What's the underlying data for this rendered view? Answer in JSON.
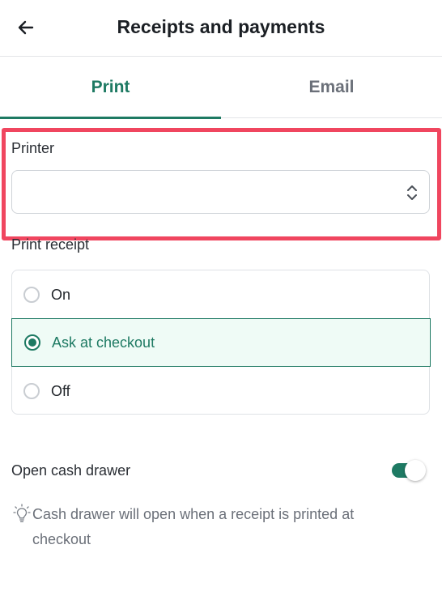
{
  "header": {
    "title": "Receipts and payments",
    "back_icon": "arrow-left-icon"
  },
  "tabs": [
    {
      "label": "Print",
      "active": true
    },
    {
      "label": "Email",
      "active": false
    }
  ],
  "printer": {
    "label": "Printer",
    "value": "",
    "icon": "chevron-up-down-icon"
  },
  "print_receipt": {
    "label": "Print receipt",
    "options": [
      {
        "label": "On",
        "selected": false
      },
      {
        "label": "Ask at checkout",
        "selected": true
      },
      {
        "label": "Off",
        "selected": false
      }
    ]
  },
  "cash_drawer": {
    "label": "Open cash drawer",
    "enabled": true,
    "hint": "Cash drawer will open when a receipt is printed at checkout",
    "hint_icon": "lightbulb-icon"
  },
  "colors": {
    "accent": "#1e7a63",
    "highlight": "#f0465f",
    "selected_bg": "#effbf6"
  }
}
